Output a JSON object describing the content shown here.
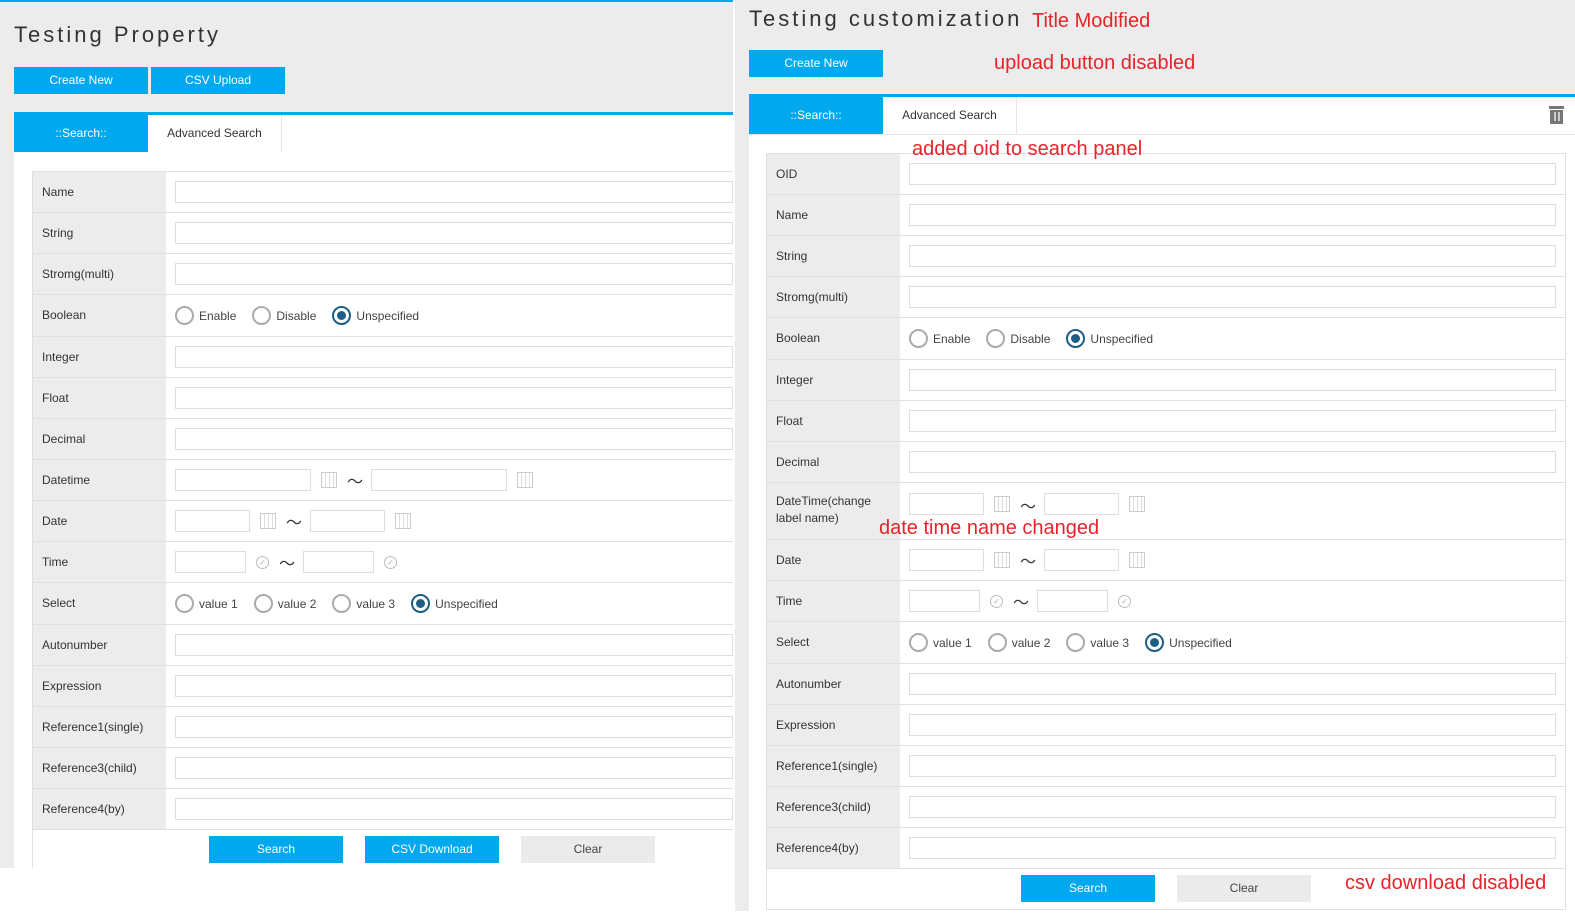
{
  "left": {
    "title": "Testing Property",
    "buttons": {
      "create_new": "Create New",
      "csv_upload": "CSV Upload"
    },
    "tabs": [
      {
        "label": "::Search::",
        "active": true
      },
      {
        "label": "Advanced Search",
        "active": false
      }
    ],
    "fields": {
      "name": "Name",
      "string": "String",
      "string_multi": "Stromg(multi)",
      "boolean": "Boolean",
      "integer": "Integer",
      "float": "Float",
      "decimal": "Decimal",
      "datetime": "Datetime",
      "date": "Date",
      "time": "Time",
      "select": "Select",
      "autonumber": "Autonumber",
      "expression": "Expression",
      "ref1": "Reference1(single)",
      "ref3": "Reference3(child)",
      "ref4": "Reference4(by)"
    },
    "boolean_options": [
      "Enable",
      "Disable",
      "Unspecified"
    ],
    "boolean_selected": "Unspecified",
    "select_options": [
      "value 1",
      "value 2",
      "value 3",
      "Unspecified"
    ],
    "select_selected": "Unspecified",
    "range_separator": "〜",
    "actions": {
      "search": "Search",
      "csv_download": "CSV Download",
      "clear": "Clear"
    }
  },
  "right": {
    "title": "Testing customization",
    "buttons": {
      "create_new": "Create New"
    },
    "tabs": [
      {
        "label": "::Search::",
        "active": true
      },
      {
        "label": "Advanced Search",
        "active": false
      }
    ],
    "trash_icon": "trash-icon",
    "fields": {
      "oid": "OID",
      "name": "Name",
      "string": "String",
      "string_multi": "Stromg(multi)",
      "boolean": "Boolean",
      "integer": "Integer",
      "float": "Float",
      "decimal": "Decimal",
      "datetime": "DateTime(change label name)",
      "date": "Date",
      "time": "Time",
      "select": "Select",
      "autonumber": "Autonumber",
      "expression": "Expression",
      "ref1": "Reference1(single)",
      "ref3": "Reference3(child)",
      "ref4": "Reference4(by)"
    },
    "boolean_options": [
      "Enable",
      "Disable",
      "Unspecified"
    ],
    "boolean_selected": "Unspecified",
    "select_options": [
      "value 1",
      "value 2",
      "value 3",
      "Unspecified"
    ],
    "select_selected": "Unspecified",
    "range_separator": "〜",
    "actions": {
      "search": "Search",
      "clear": "Clear"
    }
  },
  "annotations": {
    "title_modified": "Title Modified",
    "upload_disabled": "upload button disabled",
    "oid_added": "added oid to search panel",
    "datetime_changed": "date time name changed",
    "csv_disabled": "csv download disabled"
  },
  "colors": {
    "accent": "#00a8f0",
    "annotation": "#e8232a",
    "radio_checked": "#1d5e86",
    "label_bg": "#ececec"
  }
}
